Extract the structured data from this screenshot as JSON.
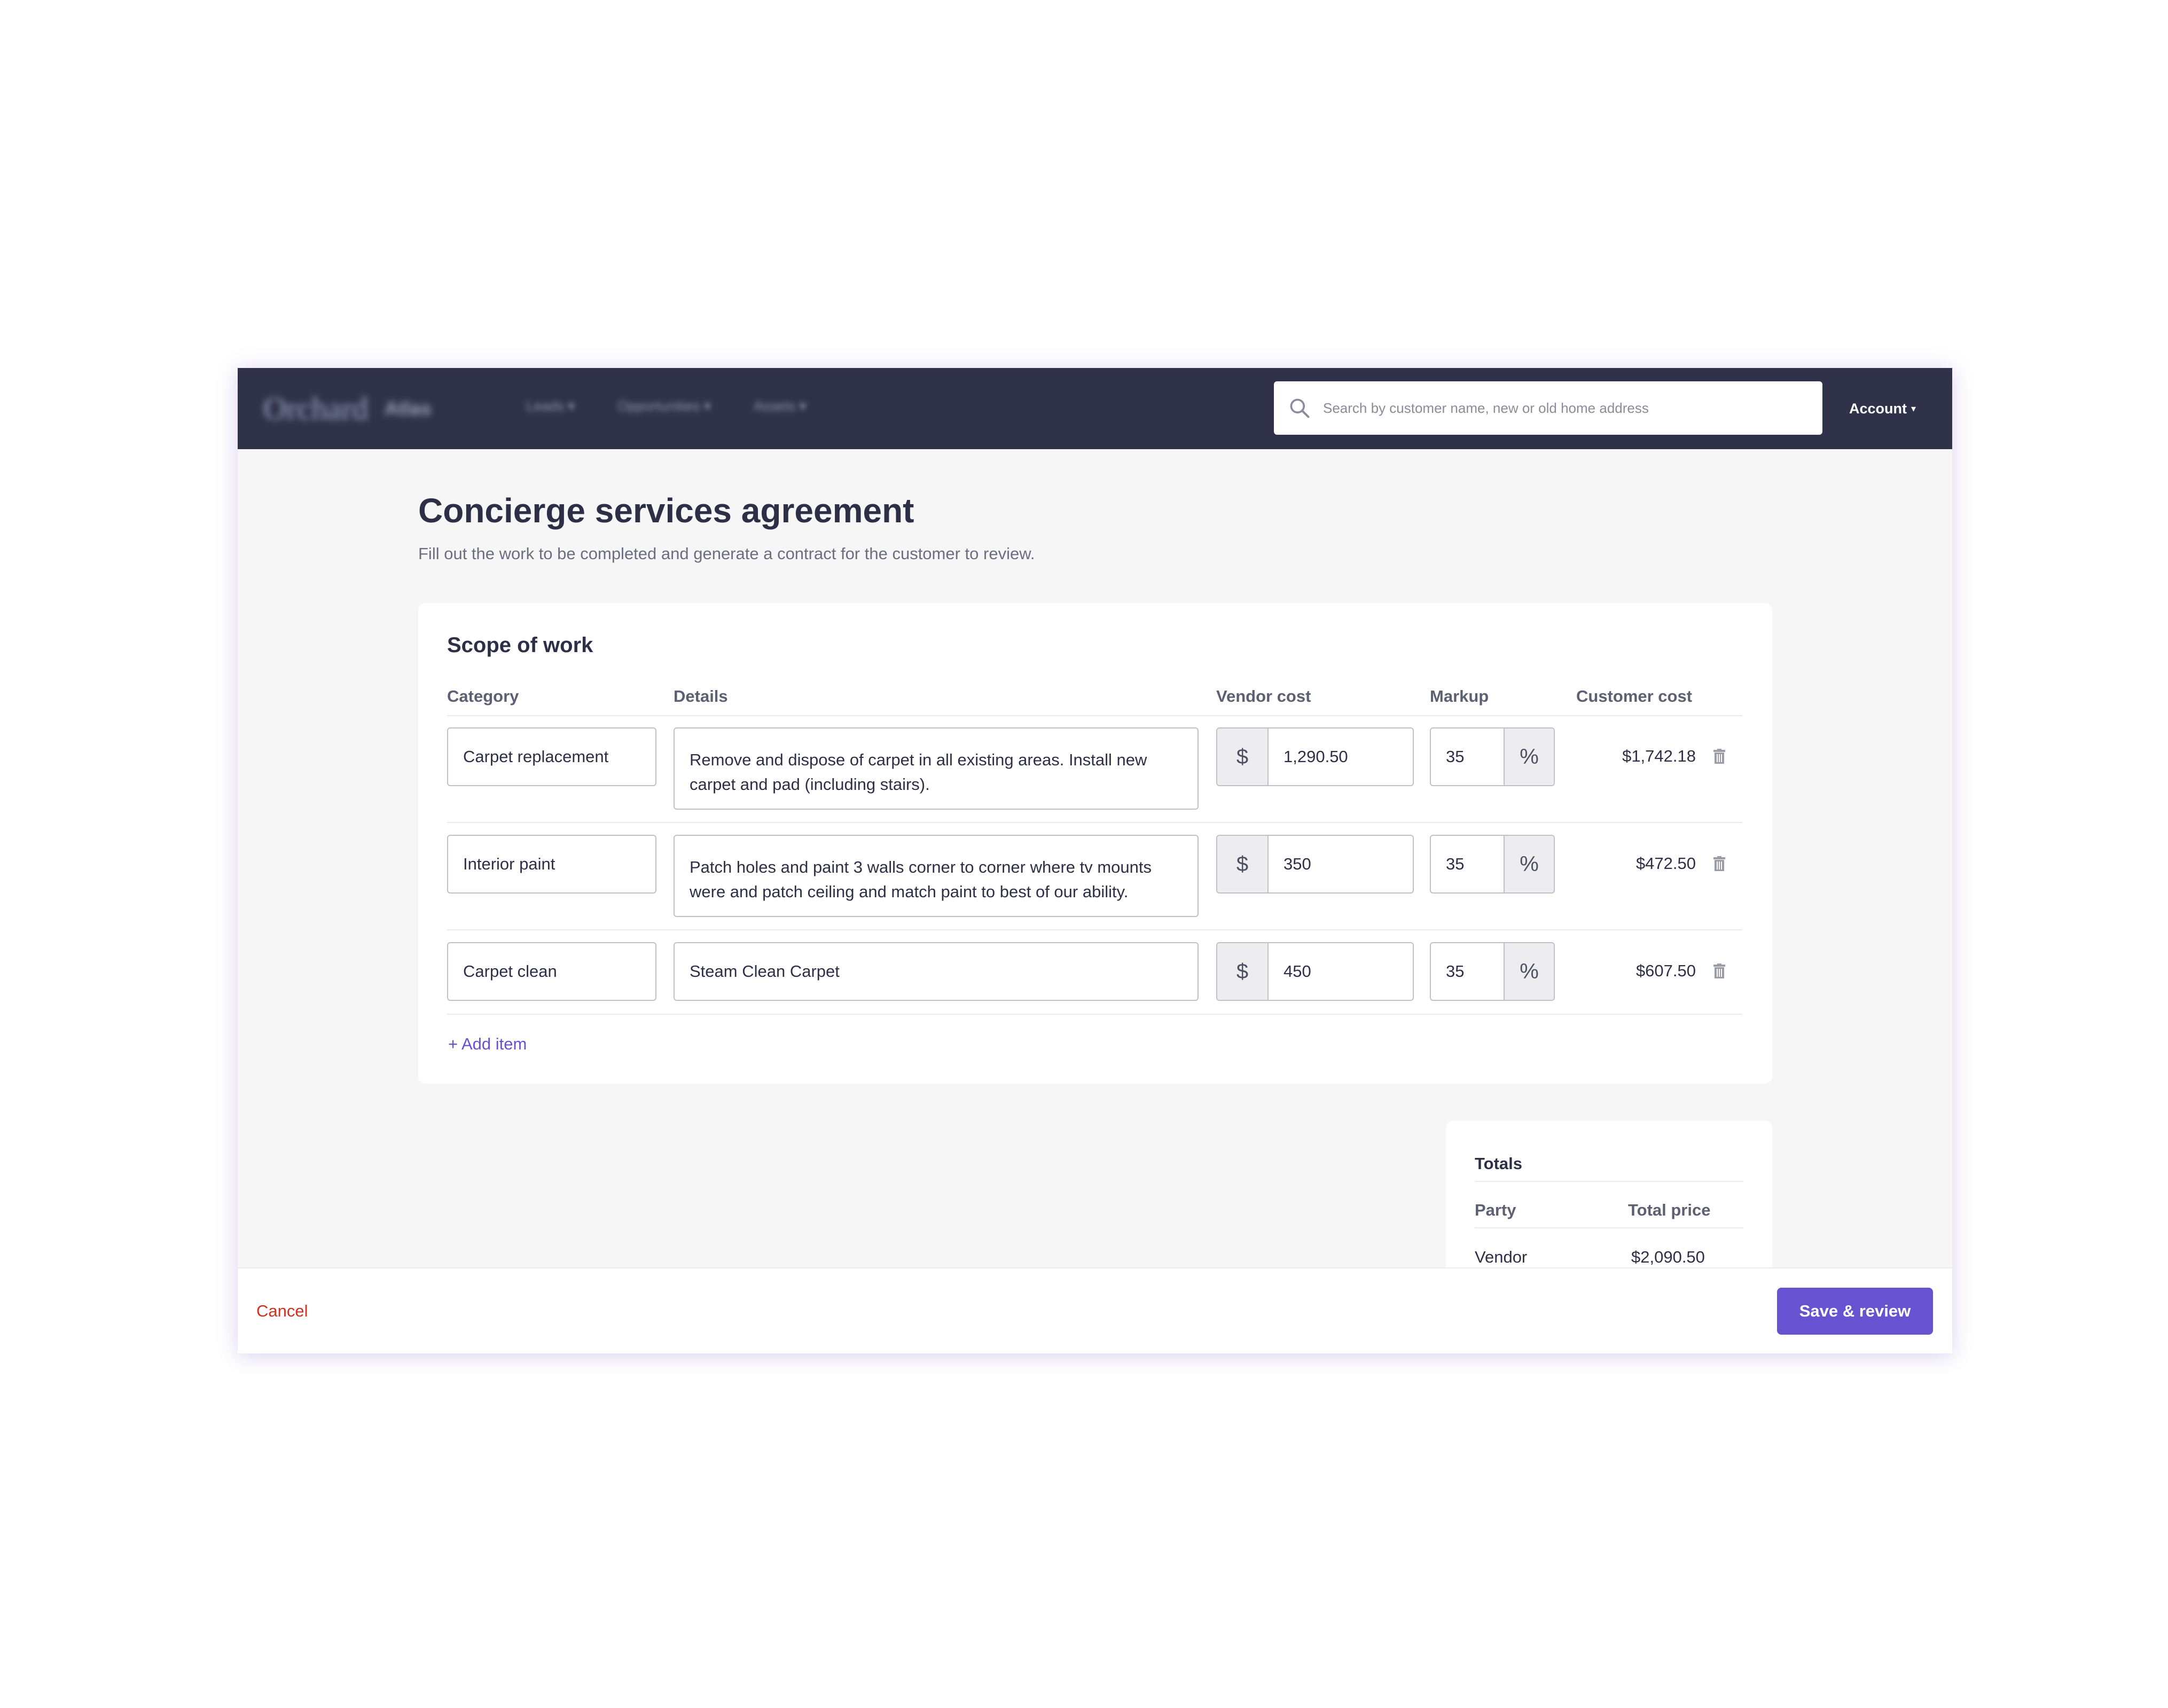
{
  "nav": {
    "logo": "Orchard",
    "logo_sub": "Atlas",
    "links": [
      "Leads",
      "Opportunities",
      "Assets"
    ],
    "search_placeholder": "Search by customer name, new or old home address",
    "account_label": "Account"
  },
  "page": {
    "title": "Concierge services agreement",
    "subtitle": "Fill out the work to be completed and generate a contract for the customer to review."
  },
  "scope": {
    "title": "Scope of work",
    "columns": {
      "category": "Category",
      "details": "Details",
      "vendor_cost": "Vendor cost",
      "markup": "Markup",
      "customer_cost": "Customer cost"
    },
    "currency_symbol": "$",
    "percent_symbol": "%",
    "items": [
      {
        "category": "Carpet replacement",
        "details": "Remove and dispose of carpet in all existing areas. Install new carpet and pad (including stairs).",
        "vendor_cost": "1,290.50",
        "markup": "35",
        "customer_cost": "$1,742.18"
      },
      {
        "category": "Interior paint",
        "details": "Patch holes and paint 3 walls corner to corner where tv mounts were and patch ceiling and match paint to best of our ability.",
        "vendor_cost": "350",
        "markup": "35",
        "customer_cost": "$472.50"
      },
      {
        "category": "Carpet clean",
        "details": "Steam Clean Carpet",
        "vendor_cost": "450",
        "markup": "35",
        "customer_cost": "$607.50"
      }
    ],
    "add_item_label": "+ Add item"
  },
  "totals": {
    "title": "Totals",
    "columns": {
      "party": "Party",
      "total_price": "Total price"
    },
    "rows": [
      {
        "party": "Vendor",
        "total_price": "$2,090.50"
      }
    ]
  },
  "footer": {
    "cancel_label": "Cancel",
    "save_label": "Save & review"
  },
  "colors": {
    "nav_bg": "#303249",
    "accent": "#6753d1",
    "danger": "#d1321f"
  }
}
